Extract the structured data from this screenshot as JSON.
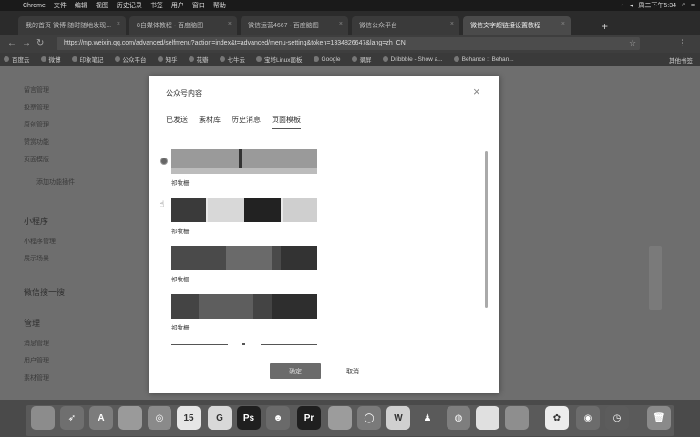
{
  "menubar": {
    "app": "Chrome",
    "items": [
      "文件",
      "编辑",
      "视图",
      "历史记录",
      "书签",
      "用户",
      "窗口",
      "帮助"
    ],
    "clock": "周二下午5:34"
  },
  "tabs": [
    {
      "label": "我的首页 微博-随时随地发现..."
    },
    {
      "label": "8自媒体教程 - 百度脑图"
    },
    {
      "label": "微信运营4667 - 百度脑图"
    },
    {
      "label": "微信公众平台"
    },
    {
      "label": "微信文字超链接设置教程"
    }
  ],
  "address": {
    "url": "https://mp.weixin.qq.com/advanced/selfmenu?action=index&t=advanced/menu-setting&token=1334826647&lang=zh_CN"
  },
  "bookmarks": [
    "百度云",
    "微博",
    "印象笔记",
    "公众平台",
    "知乎",
    "花瓣",
    "七牛云",
    "宝塔Linux面板",
    "Google",
    "录屏",
    "Dribbble - Show a...",
    "Behance :: Behan..."
  ],
  "bookmarks_other": "其他书签",
  "sidenav": {
    "items": [
      "留言管理",
      "投票管理",
      "原创管理",
      "赞赏功能",
      "页面模版",
      "添加功能插件",
      "小程序",
      "小程序管理",
      "展示场景",
      "微信搜一搜",
      "管理",
      "消息管理",
      "用户管理",
      "素材管理"
    ]
  },
  "modal": {
    "title": "公众号内容",
    "close_symbol": "×",
    "tabs": [
      {
        "label": "已发送"
      },
      {
        "label": "素材库"
      },
      {
        "label": "历史消息"
      },
      {
        "label": "页面模板"
      }
    ],
    "items": [
      {
        "label": "祁牧栅"
      },
      {
        "label": "祁牧栅"
      },
      {
        "label": "祁牧栅"
      },
      {
        "label": "祁牧栅"
      }
    ],
    "confirm_label": "确定",
    "cancel_label": "取消"
  },
  "dock": {
    "icons": [
      "finder-icon",
      "launchpad-icon",
      "appstore-icon",
      "preview-icon",
      "safari-icon",
      "calendar-icon",
      "grapher-icon",
      "photoshop-icon",
      "game-icon",
      "premiere-icon",
      "keynote-icon",
      "quicktime-icon",
      "wps-icon",
      "qq-icon",
      "wechat-icon",
      "notes-icon",
      "finder-folder-icon",
      "baidu-icon",
      "chrome-icon",
      "time-icon",
      "trash-icon"
    ],
    "calendar_day": "15",
    "ps_label": "Ps",
    "pr_label": "Pr"
  }
}
